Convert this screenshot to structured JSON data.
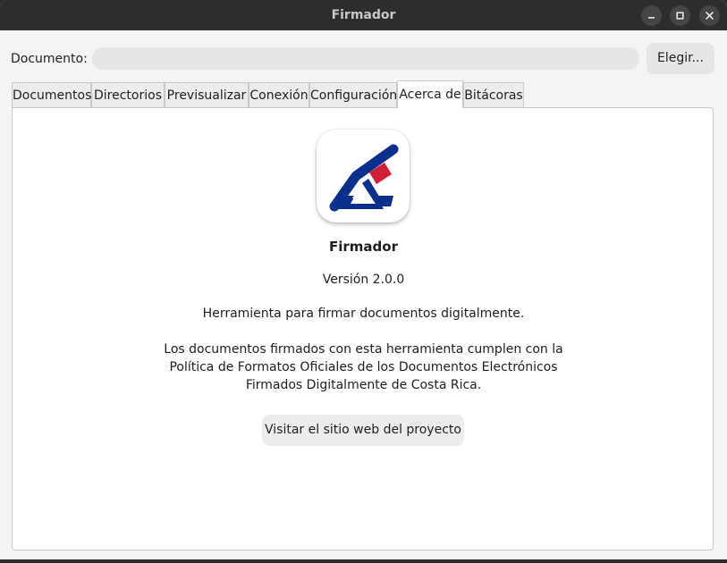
{
  "window": {
    "title": "Firmador"
  },
  "document_row": {
    "label": "Documento:",
    "value": "",
    "choose_label": "Elegir..."
  },
  "tabs": [
    {
      "label": "Documentos",
      "active": false
    },
    {
      "label": "Directorios",
      "active": false
    },
    {
      "label": "Previsualizar",
      "active": false
    },
    {
      "label": "Conexión",
      "active": false
    },
    {
      "label": "Configuración",
      "active": false
    },
    {
      "label": "Acerca de",
      "active": true
    },
    {
      "label": "Bitácoras",
      "active": false
    }
  ],
  "about": {
    "app_name": "Firmador",
    "version": "Versión 2.0.0",
    "description": "Herramienta para firmar documentos digitalmente.",
    "legal_line1": "Los documentos firmados con esta herramienta cumplen con la",
    "legal_line2": "Política de Formatos Oficiales de los Documentos Electrónicos",
    "legal_line3": "Firmados Digitalmente de Costa Rica.",
    "website_button": "Visitar el sitio web del proyecto"
  },
  "colors": {
    "logo_blue": "#0b2f8c",
    "logo_red": "#cf1f3a",
    "titlebar": "#2d2d2d"
  },
  "icons": {
    "app_logo": "firmador-logo-icon",
    "minimize": "minimize-icon",
    "maximize": "maximize-icon",
    "close": "close-icon"
  }
}
